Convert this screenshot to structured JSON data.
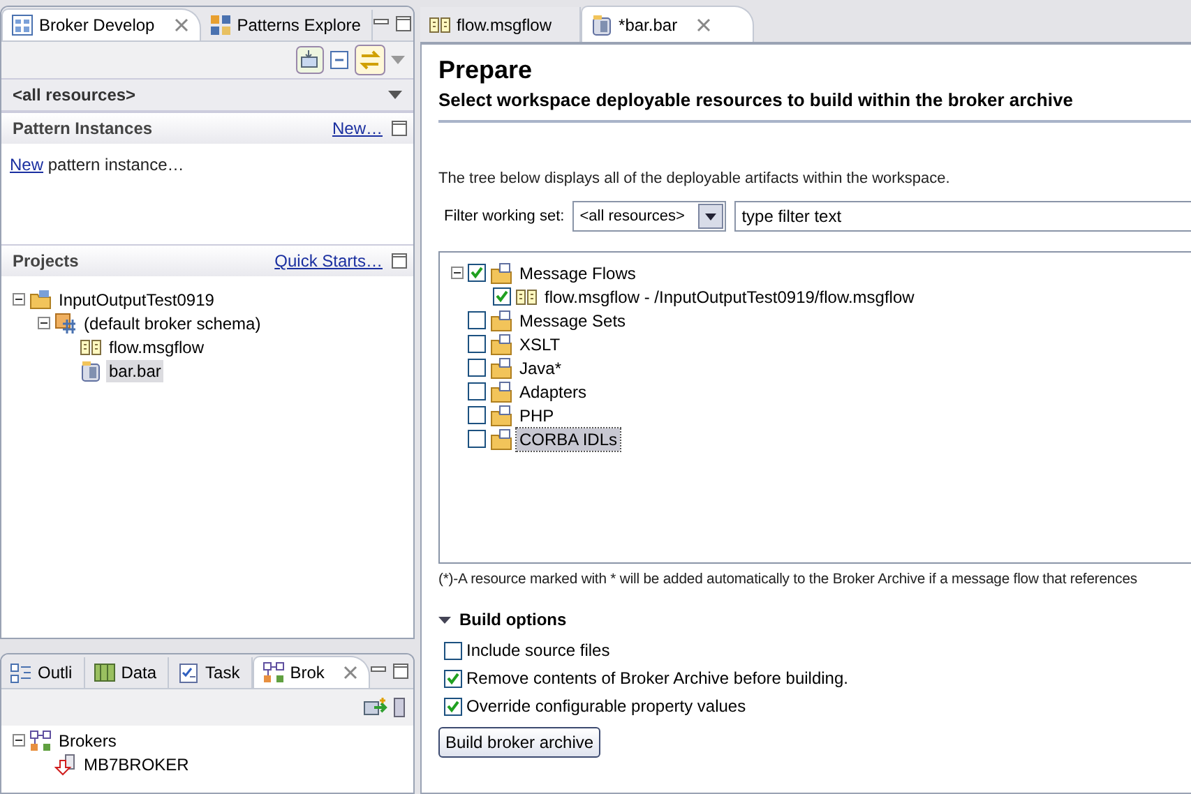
{
  "left_view": {
    "tabs": [
      {
        "label": "Broker Develop",
        "kind": "grid",
        "selected": true
      },
      {
        "label": "Patterns Explore",
        "kind": "pattern",
        "selected": false
      }
    ],
    "working_set": "<all resources>",
    "pattern_instances": {
      "title": "Pattern Instances",
      "action": "New…",
      "link": "New",
      "text": "pattern instance…"
    },
    "projects": {
      "title": "Projects",
      "action": "Quick Starts…",
      "tree": [
        {
          "label": "InputOutputTest0919",
          "kind": "project",
          "selected": false,
          "expanded": true,
          "children": [
            {
              "label": "(default broker schema)",
              "kind": "schema",
              "selected": false,
              "expanded": true,
              "children": [
                {
                  "label": "flow.msgflow",
                  "kind": "msgflow",
                  "selected": false
                },
                {
                  "label": "bar.bar",
                  "kind": "bar",
                  "selected": true
                }
              ]
            }
          ]
        }
      ]
    }
  },
  "bottom_view": {
    "tabs": [
      {
        "label": "Outli",
        "kind": "outline",
        "selected": false
      },
      {
        "label": "Data",
        "kind": "data",
        "selected": false
      },
      {
        "label": "Task",
        "kind": "task",
        "selected": false
      },
      {
        "label": "Brok",
        "kind": "brokers",
        "selected": true
      }
    ],
    "tree": [
      {
        "label": "Brokers",
        "kind": "brokers",
        "selected": false,
        "expanded": true,
        "children": [
          {
            "label": "MB7BROKER",
            "kind": "broker",
            "selected": false
          }
        ]
      }
    ]
  },
  "editor": {
    "tabs": [
      {
        "label": "flow.msgflow",
        "kind": "msgflow",
        "selected": false
      },
      {
        "label": "*bar.bar",
        "kind": "bar",
        "selected": true
      }
    ],
    "title": "Prepare",
    "subtitle": "Select workspace deployable resources to build within the broker archive",
    "description": "The tree below displays all of the deployable artifacts within the workspace.",
    "filter": {
      "label": "Filter working set:",
      "working_set": "<all resources>",
      "placeholder": "type filter text"
    },
    "resources": [
      {
        "label": "Message Flows",
        "kind": "folder",
        "checked": true,
        "selected": false,
        "expanded": true,
        "children": [
          {
            "label": "flow.msgflow - /InputOutputTest0919/flow.msgflow",
            "kind": "msgflow",
            "checked": true,
            "selected": false
          }
        ]
      },
      {
        "label": "Message Sets",
        "kind": "folder",
        "checked": false,
        "selected": false
      },
      {
        "label": "XSLT",
        "kind": "folder",
        "checked": false,
        "selected": false
      },
      {
        "label": "Java*",
        "kind": "folder",
        "checked": false,
        "selected": false
      },
      {
        "label": "Adapters",
        "kind": "folder",
        "checked": false,
        "selected": false
      },
      {
        "label": "PHP",
        "kind": "folder",
        "checked": false,
        "selected": false
      },
      {
        "label": "CORBA IDLs",
        "kind": "folder",
        "checked": false,
        "selected": true
      }
    ],
    "footnote": "(*)-A resource marked with * will be added automatically to the Broker Archive if a message flow that references",
    "build_options": {
      "title": "Build options",
      "expanded": true,
      "options": [
        {
          "label": "Include source files",
          "checked": false
        },
        {
          "label": "Remove contents of Broker Archive before building.",
          "checked": true
        },
        {
          "label": "Override configurable property values",
          "checked": true
        }
      ]
    },
    "button": "Build broker archive"
  }
}
